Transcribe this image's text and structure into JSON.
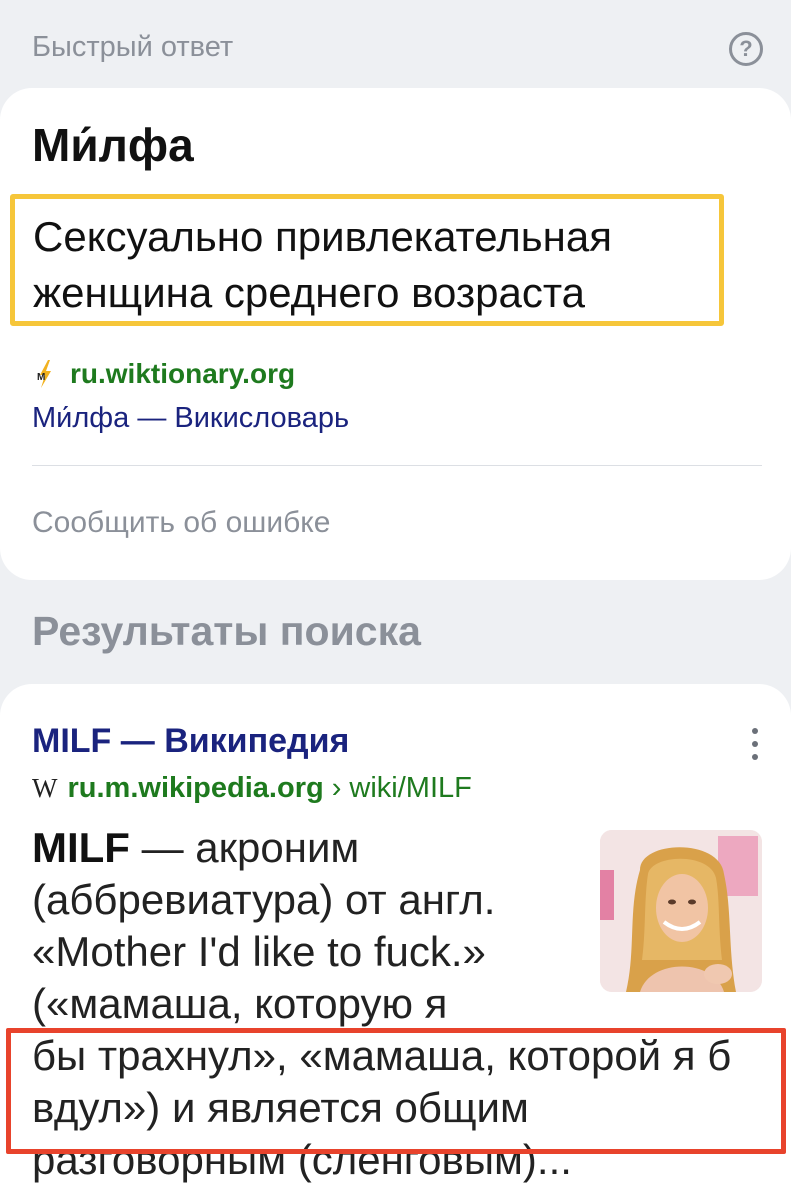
{
  "quick_answer": {
    "header_title": "Быстрый ответ",
    "help_icon": "question-circle-icon",
    "term": "Ми́лфа",
    "definition": "Сексуально привлекательная женщина среднего возраста",
    "definition_highlight_color": "#f6c63a",
    "source_icon": "wiktionary-icon",
    "source_domain": "ru.wiktionary.org",
    "source_title": "Ми́лфа — Викисловарь",
    "report_label": "Сообщить об ошибке"
  },
  "results": {
    "heading": "Результаты поиска",
    "items": [
      {
        "title": "MILF — Википедия",
        "menu_icon": "more-vertical-icon",
        "site_icon": "wikipedia-icon",
        "site_icon_glyph": "W",
        "domain": "ru.m.wikipedia.org",
        "path": "› wiki/MILF",
        "snippet_term": "MILF",
        "snippet_narrow": " — акроним (аббревиатура) от англ. «Mother I'd like to fuck.» («мамаша, которую я",
        "snippet_wide": "бы трахнул», «мамаша, которой я б вдул») и является общим разговорным (сленговым)...",
        "thumbnail": "person-photo",
        "highlight_color": "#e8432c"
      }
    ]
  }
}
